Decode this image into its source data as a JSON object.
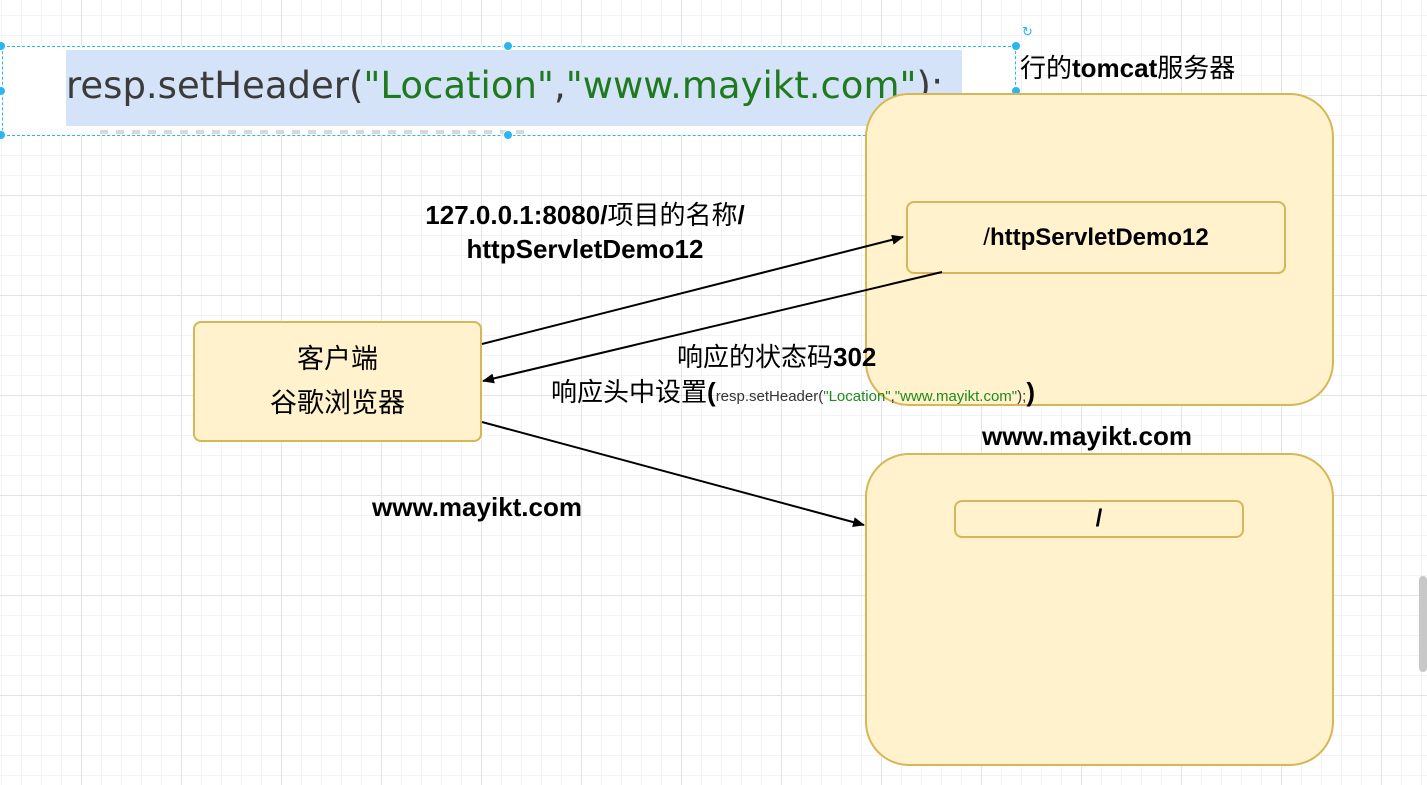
{
  "code_snippet": {
    "prefix": "resp.setHeader(",
    "arg1": "\"Location\"",
    "comma": ",",
    "arg2": "\"www.mayikt.com\"",
    "suffix": ");"
  },
  "tomcat_server": {
    "title_partial": "行的",
    "title_bold": "tomcat",
    "title_tail": "服务器",
    "path_box_slash": "/",
    "path_box_text": "httpServletDemo12"
  },
  "client": {
    "line1": "客户端",
    "line2": "谷歌浏览器"
  },
  "request_label": {
    "address": "127.0.0.1:8080/",
    "project_name": "项目的名称",
    "trailing_slash": "/",
    "line2": "httpServletDemo12"
  },
  "response_label": {
    "line1_text": "响应的状态码",
    "line1_code": "302",
    "line2_text": "响应头中设置",
    "open_paren": "(",
    "mini_prefix": "resp.setHeader(",
    "mini_arg1": "\"Location\"",
    "mini_comma": ",",
    "mini_arg2": "\"www.mayikt.com\"",
    "mini_suffix": ");",
    "close_paren": ")"
  },
  "redirect_label": "www.mayikt.com",
  "mayikt_server": {
    "title": "www.mayikt.com",
    "root_path": "/"
  },
  "colors": {
    "box_fill": "#fff2cc",
    "box_border": "#d6b656",
    "selection": "#29b6f2",
    "code_string": "#1f7a1f"
  },
  "icons": [
    "rotate-handle-icon"
  ]
}
